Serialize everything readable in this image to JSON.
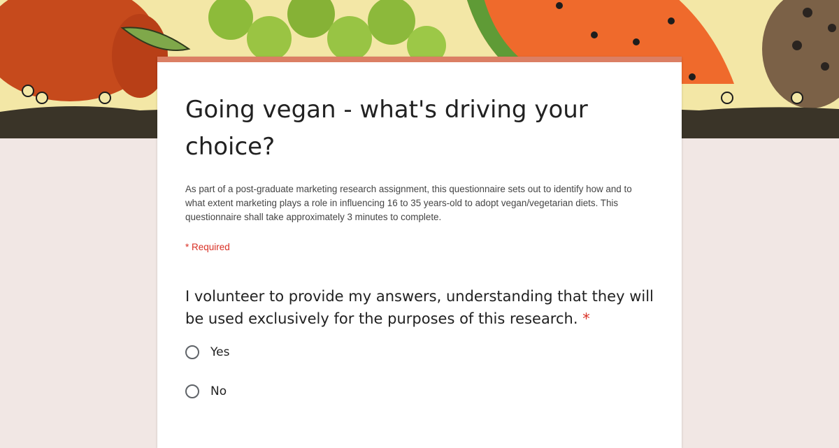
{
  "form": {
    "title": "Going vegan - what's driving your choice?",
    "description": "As part of a post-graduate marketing research assignment, this questionnaire sets out to identify how and to what extent marketing plays a role in influencing 16 to 35 years-old to adopt vegan/vegetarian diets. This questionnaire shall take approximately 3 minutes to complete.",
    "required_note": "* Required",
    "accent_color": "#db7f64"
  },
  "question": {
    "text": "I volunteer to provide my answers, understanding that they will be used exclusively for the purposes of this research.",
    "required_marker": "*",
    "options": [
      "Yes",
      "No"
    ]
  },
  "banner": {
    "background_color": "#f3e7a6",
    "soil_color": "#3a3428",
    "icons": [
      "apple-illustration",
      "grapes-illustration",
      "watermelon-illustration",
      "cookie-illustration",
      "ant-icon"
    ]
  }
}
